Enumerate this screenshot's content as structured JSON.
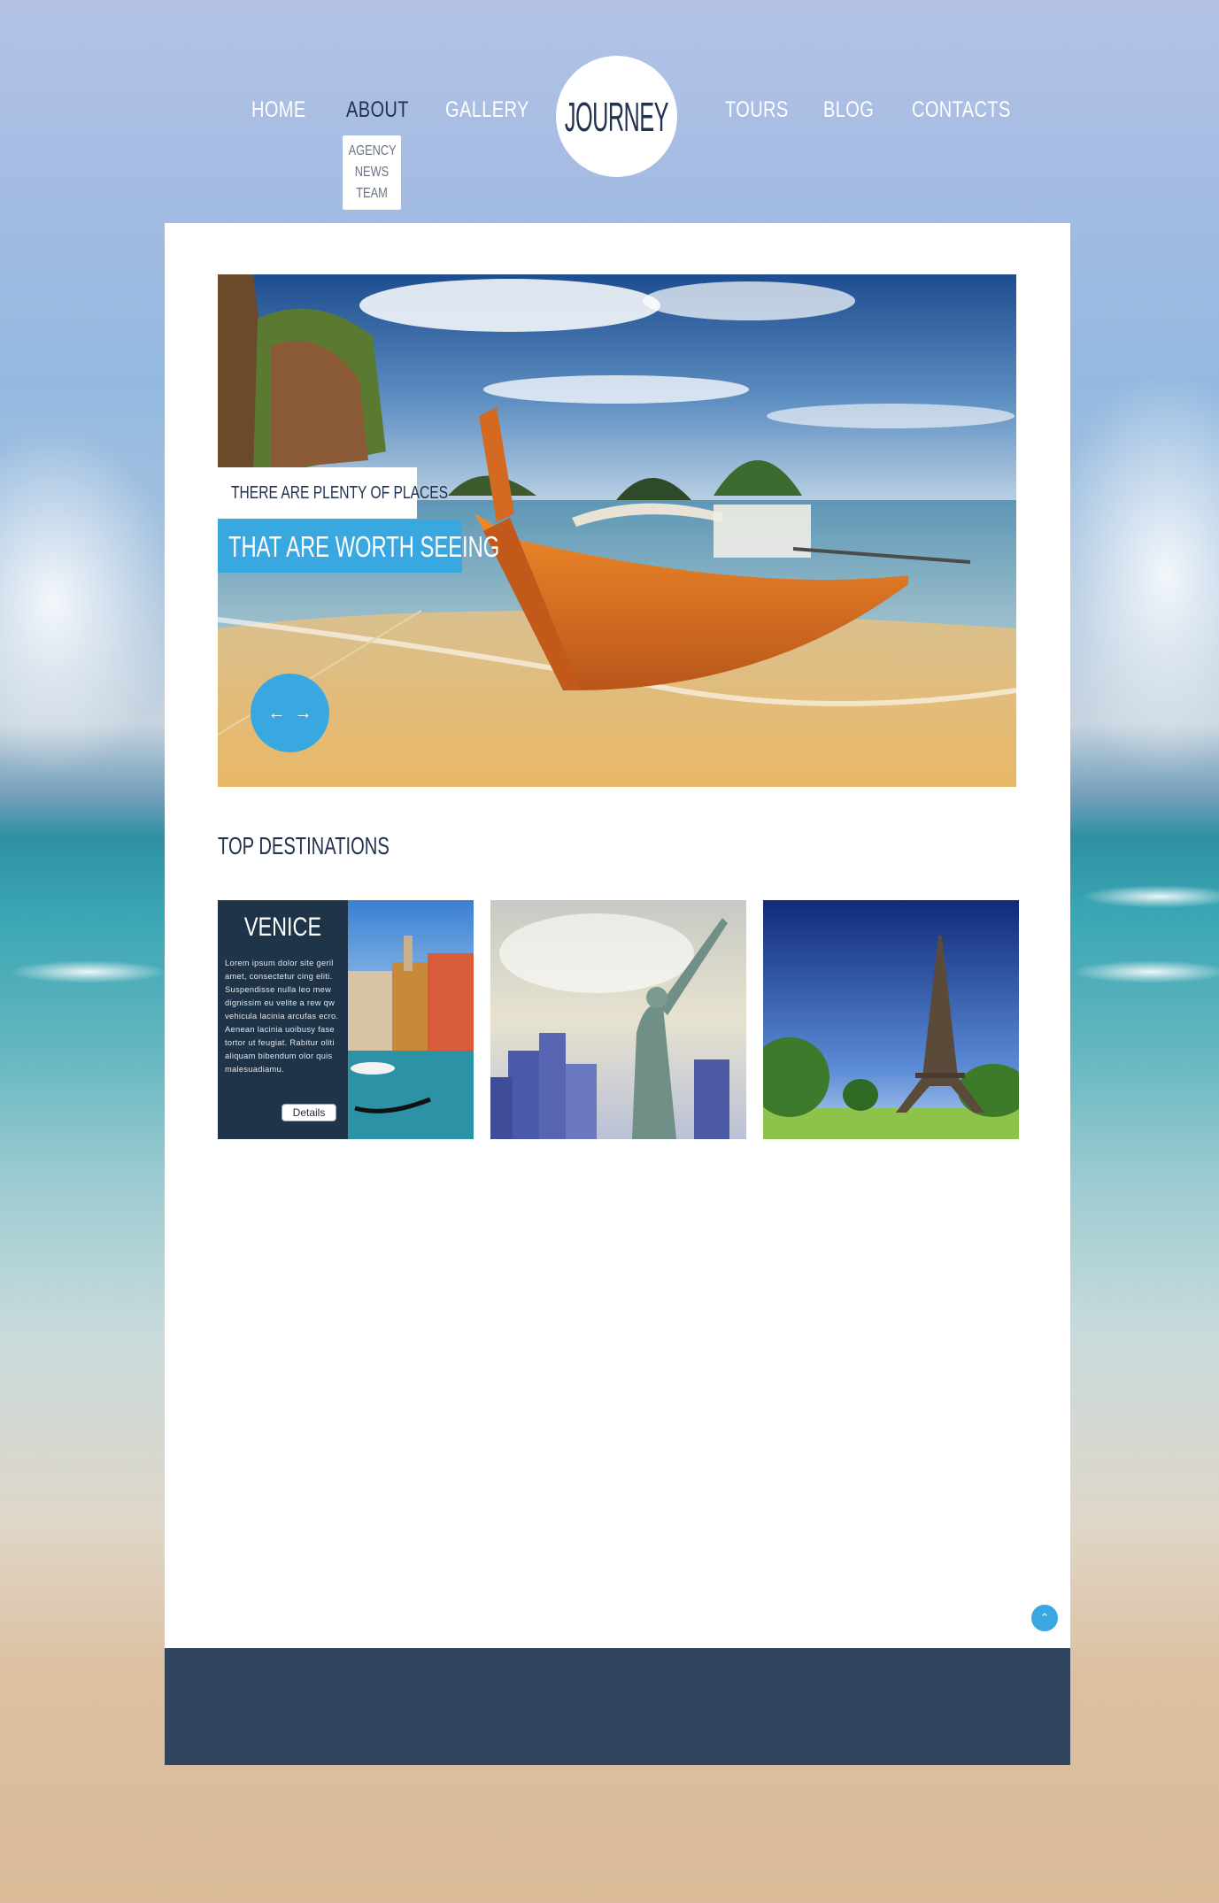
{
  "nav": {
    "left": [
      "HOME",
      "ABOUT",
      "GALLERY"
    ],
    "right": [
      "TOURS",
      "BLOG",
      "CONTACTS"
    ],
    "active": "ABOUT",
    "about_submenu": [
      "AGENCY",
      "NEWS",
      "TEAM"
    ],
    "logo": "JOURNEY"
  },
  "hero": {
    "caption_small": "THERE ARE PLENTY OF PLACES",
    "caption_large": "THAT ARE WORTH SEEING",
    "prev_icon": "arrow-left-icon",
    "next_icon": "arrow-right-icon"
  },
  "destinations": {
    "title": "TOP DESTINATIONS",
    "cards": [
      {
        "name": "VENICE",
        "text": "Lorem ipsum dolor site geril amet, consectetur cing eliti. Suspendisse nulla leo mew dignissim eu velite a rew qw vehicula lacinia arcufas ecro. Aenean lacinia uoibusy fase tortor ut feugiat. Rabitur oliti aliquam bibendum olor quis malesuadiamu.",
        "button": "Details",
        "image": "venice-canal"
      },
      {
        "image": "statue-of-liberty"
      },
      {
        "image": "eiffel-tower"
      }
    ]
  },
  "scroll_top_icon": "chevron-up-icon",
  "colors": {
    "accent": "#39a8e0",
    "navy": "#22324f",
    "footer": "#32455e",
    "card_overlay": "#1f3349"
  }
}
